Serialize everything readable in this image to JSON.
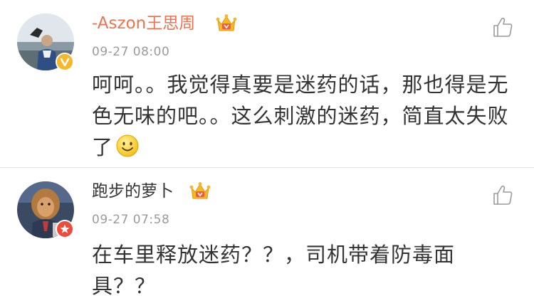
{
  "comments": [
    {
      "username": "-Aszon王思周",
      "timestamp": "09-27 08:00",
      "text": "呵呵。。我觉得真要是迷药的话，那也得是无色无味的吧。。这么刺激的迷药，简直太失败了",
      "badge": "yellow-v-badge",
      "emoji": "smile-emoji",
      "name_color": "#eb7350"
    },
    {
      "username": "跑步的萝卜",
      "timestamp": "09-27 07:58",
      "text": "在车里释放迷药？？，司机带着防毒面具？？",
      "badge": "red-star-badge",
      "name_color": "#333333"
    }
  ],
  "colors": {
    "accent": "#eb7350",
    "crown_gold": "#f6b828",
    "timestamp": "#9a9a9a",
    "text": "#333333",
    "divider": "#e2e2e2"
  }
}
